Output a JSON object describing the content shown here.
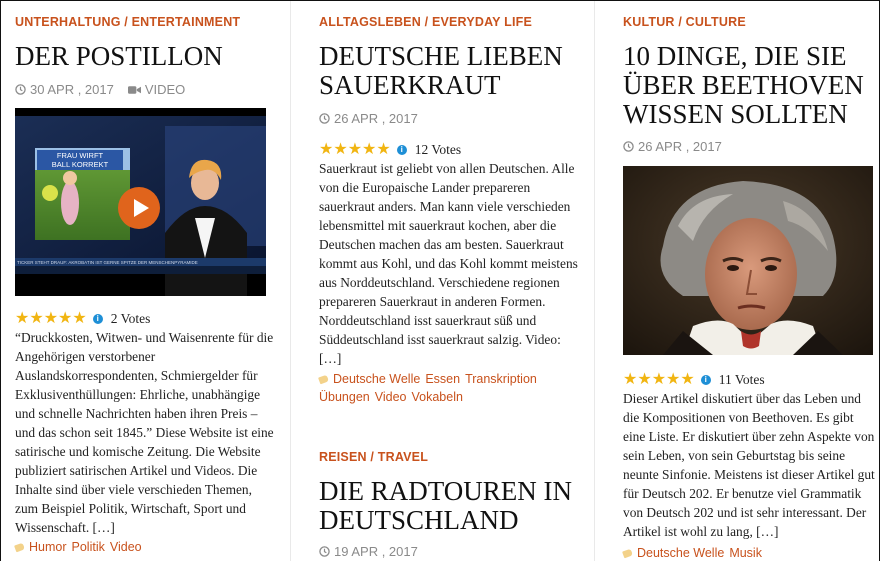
{
  "articles": [
    {
      "category": "UNTERHALTUNG / ENTERTAINMENT",
      "title": "DER POSTILLON",
      "date": "30 APR , 2017",
      "media_type": "VIDEO",
      "video": {
        "banner_line1": "FRAU WIRFT",
        "banner_line2": "BALL KORREKT",
        "ticker": "TICKER     STEHT DRAUF: AKROBATIN IST GERNE SPITZE DER MENSCHENPYRAMIDE"
      },
      "rating": {
        "stars": 5,
        "votes": "2 Votes"
      },
      "excerpt": "“Druckkosten, Witwen- und Waisenrente für die Angehörigen verstorbener Auslandskorrespondenten, Schmiergelder für Exklusiventhüllungen: Ehrliche, unabhängige und schnelle Nachrichten haben ihren Preis – und das schon seit 1845.” Diese Website ist eine satirische und komische Zeitung. Die Website publiziert satirischen Artikel und Videos. Die Inhalte sind über viele verschieden Themen, zum Beispiel Politik, Wirtschaft, Sport und Wissenschaft. […]",
      "tags": [
        "Humor",
        "Politik",
        "Video"
      ]
    },
    {
      "category": "ALLTAGSLEBEN / EVERYDAY LIFE",
      "title": "DEUTSCHE LIEBEN SAUERKRAUT",
      "date": "26 APR , 2017",
      "rating": {
        "stars": 5,
        "votes": "12 Votes"
      },
      "excerpt": "Sauerkraut ist geliebt von allen Deutschen. Alle von die Europaische Lander prepareren sauerkraut anders. Man kann viele verschieden lebensmittel mit sauerkraut kochen, aber die Deutschen machen das am besten. Sauerkraut kommt aus Kohl, und das Kohl kommt meistens aus Norddeutschland. Verschiedene regionen prepareren Sauerkraut in anderen Formen. Norddeutschland isst sauerkraut süß und Süddeutschland isst sauerkraut salzig. Video: […]",
      "tags": [
        "Deutsche Welle",
        "Essen",
        "Transkription",
        "Übungen",
        "Video",
        "Vokabeln"
      ]
    },
    {
      "category": "REISEN / TRAVEL",
      "title": "DIE RADTOUREN IN DEUTSCHLAND",
      "date": "19 APR , 2017"
    },
    {
      "category": "KULTUR / CULTURE",
      "title": "10 DINGE, DIE SIE ÜBER BEETHOVEN WISSEN SOLLTEN",
      "date": "26 APR , 2017",
      "rating": {
        "stars": 5,
        "votes": "11 Votes"
      },
      "excerpt": "Dieser Artikel diskutiert über das Leben und die Kompositionen von Beethoven. Es gibt eine Liste. Er diskutiert über zehn Aspekte von sein Leben, von sein Geburtstag bis seine neunte Sinfonie. Meistens ist dieser Artikel gut für Deutsch 202. Er benutze viel Grammatik von Deutsch 202 und ist sehr interessant. Der Artikel ist wohl zu lang, […]",
      "tags": [
        "Deutsche Welle",
        "Musik"
      ]
    }
  ],
  "icons": {
    "clock": "clock-icon",
    "camera": "video-camera-icon",
    "star": "star-icon",
    "info": "info-icon",
    "tag": "tag-icon",
    "play": "play-icon"
  },
  "colors": {
    "accent": "#c8521d",
    "star": "#f1b512",
    "info": "#1e8fd6",
    "meta": "#8a8a8a"
  }
}
